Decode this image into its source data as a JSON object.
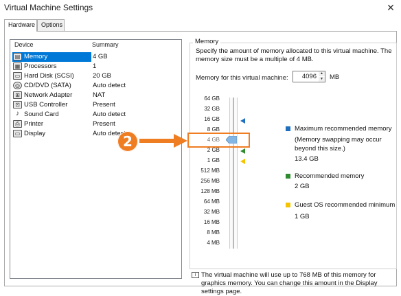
{
  "window": {
    "title": "Virtual Machine Settings"
  },
  "tabs": [
    {
      "label": "Hardware"
    },
    {
      "label": "Options"
    }
  ],
  "device_list": {
    "col_device": "Device",
    "col_summary": "Summary",
    "rows": [
      {
        "device": "Memory",
        "summary": "4 GB",
        "icon": "memory-icon",
        "selected": true
      },
      {
        "device": "Processors",
        "summary": "1",
        "icon": "processor-icon"
      },
      {
        "device": "Hard Disk (SCSI)",
        "summary": "20 GB",
        "icon": "hard-disk-icon"
      },
      {
        "device": "CD/DVD (SATA)",
        "summary": "Auto detect",
        "icon": "cd-dvd-icon"
      },
      {
        "device": "Network Adapter",
        "summary": "NAT",
        "icon": "network-adapter-icon"
      },
      {
        "device": "USB Controller",
        "summary": "Present",
        "icon": "usb-icon"
      },
      {
        "device": "Sound Card",
        "summary": "Auto detect",
        "icon": "sound-card-icon"
      },
      {
        "device": "Printer",
        "summary": "Present",
        "icon": "printer-icon"
      },
      {
        "device": "Display",
        "summary": "Auto detect",
        "icon": "display-icon"
      }
    ]
  },
  "memory": {
    "group_title": "Memory",
    "description": "Specify the amount of memory allocated to this virtual machine. The memory size must be a multiple of 4 MB.",
    "field_label": "Memory for this virtual machine:",
    "value": "4096",
    "unit": "MB",
    "scale_ticks": [
      "64 GB",
      "32 GB",
      "16 GB",
      "8 GB",
      "4 GB",
      "2 GB",
      "1 GB",
      "512 MB",
      "256 MB",
      "128 MB",
      "64 MB",
      "32 MB",
      "16 MB",
      "8 MB",
      "4 MB"
    ],
    "legend": {
      "max_title": "Maximum recommended memory",
      "max_note": "(Memory swapping may occur beyond this size.)",
      "max_value": "13.4 GB",
      "rec_title": "Recommended memory",
      "rec_value": "2 GB",
      "guest_title": "Guest OS recommended minimum",
      "guest_value": "1 GB"
    },
    "colors": {
      "max": "#1f6fbf",
      "recommended": "#2e8b2e",
      "guest_min": "#f5c400",
      "accent": "#0078d7"
    },
    "footer": "The virtual machine will use up to 768 MB of this memory for graphics memory. You can change this amount in the Display settings page."
  },
  "annotation": {
    "step": "2",
    "color": "#ef7d22"
  }
}
